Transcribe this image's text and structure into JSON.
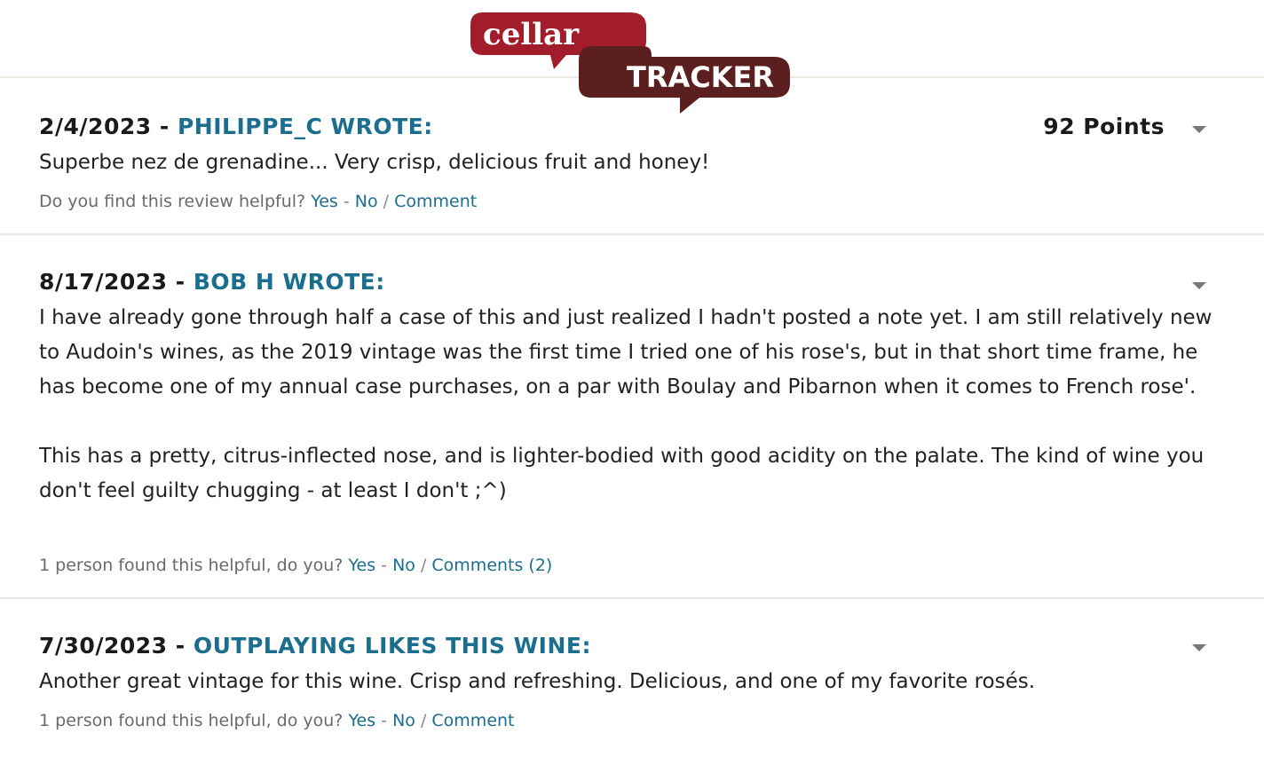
{
  "logo": {
    "top_text": "cellar",
    "bottom_text": "TRACKER",
    "colors": {
      "red": "#a11d2b",
      "brown": "#5c1f1f"
    }
  },
  "reviews": [
    {
      "date": "2/4/2023",
      "separator": "-",
      "author": "PHILIPPE_C WROTE:",
      "points": "92 Points",
      "body": "Superbe nez de grenadine... Very crisp, delicious fruit and honey!",
      "helpful_prompt": "Do you find this review helpful?",
      "yes": "Yes",
      "dash": "-",
      "no": "No",
      "slash": "/",
      "comment": "Comment"
    },
    {
      "date": "8/17/2023",
      "separator": "-",
      "author": "BOB H WROTE:",
      "body": "I have already gone through half a case of this and just realized I hadn't posted a note yet. I am still relatively new to Audoin's wines, as the 2019 vintage was the first time I tried one of his rose's, but in that short time frame, he has become one of my annual case purchases, on a par with Boulay and Pibarnon when it comes to French rose'.\n\nThis has a pretty, citrus-inflected nose, and is lighter-bodied with good acidity on the palate. The kind of wine you don't feel guilty chugging - at least I don't ;^)",
      "helpful_prompt": "1 person found this helpful, do you?",
      "yes": "Yes",
      "dash": "-",
      "no": "No",
      "slash": "/",
      "comment": "Comments (2)"
    },
    {
      "date": "7/30/2023",
      "separator": "-",
      "author": "OUTPLAYING LIKES THIS WINE:",
      "body": "Another great vintage for this wine. Crisp and refreshing. Delicious, and one of my favorite rosés.",
      "helpful_prompt": "1 person found this helpful, do you?",
      "yes": "Yes",
      "dash": "-",
      "no": "No",
      "slash": "/",
      "comment": "Comment"
    }
  ],
  "colors": {
    "link": "#1b6e8e",
    "divider": "#ecebe3"
  }
}
